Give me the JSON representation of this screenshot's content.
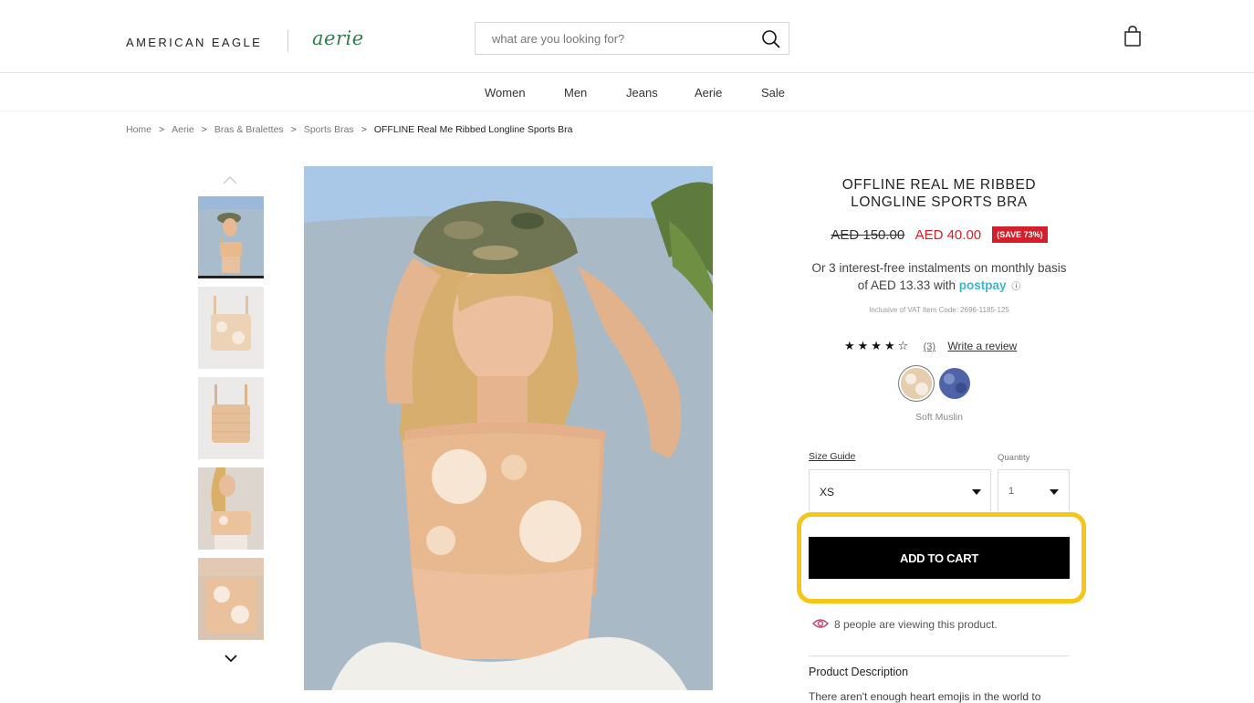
{
  "header": {
    "brand_ae": "AMERICAN EAGLE",
    "brand_aerie": "aerie",
    "search_placeholder": "what are you looking for?"
  },
  "nav": {
    "items": [
      "Women",
      "Men",
      "Jeans",
      "Aerie",
      "Sale"
    ]
  },
  "breadcrumb": {
    "items": [
      "Home",
      "Aerie",
      "Bras & Bralettes",
      "Sports Bras"
    ],
    "current": "OFFLINE Real Me Ribbed Longline Sports Bra",
    "separator": ">"
  },
  "product": {
    "title": "OFFLINE REAL ME RIBBED LONGLINE SPORTS BRA",
    "old_price": "AED 150.00",
    "new_price": "AED 40.00",
    "save_badge": "(SAVE 73%)",
    "postpay_text_1": "Or 3 interest-free instalments on monthly basis of AED 13.33 with",
    "postpay_brand": "postpay",
    "info_icon": "ⓘ",
    "vat_text": "Inclusive of VAT    Item Code: 2696-1185-125",
    "rating": {
      "stars_text": "★★★★☆",
      "value": 4,
      "max": 5,
      "count": "(3)",
      "write_review": "Write a review"
    },
    "colors": [
      {
        "name": "Soft Muslin",
        "swatch": "#e8d6bd",
        "selected": true
      },
      {
        "name": "",
        "swatch": "#4e63a8",
        "selected": false
      }
    ],
    "selected_color_name": "Soft Muslin",
    "size_guide": "Size Guide",
    "quantity_label": "Quantity",
    "size_value": "XS",
    "quantity_value": "1",
    "add_to_cart": "ADD TO CART",
    "viewers_text": "8 people are viewing this product.",
    "description_heading": "Product Description",
    "description_text": "There aren't enough heart emojis in the world to"
  },
  "colors": {
    "price_red": "#d4202a",
    "highlight": "#f5c518",
    "postpay": "#3eb5c8",
    "aerie_green": "#2e7d4a",
    "eye": "#c0436f"
  },
  "icons": [
    "search-icon",
    "bag-icon",
    "chevron-up-icon",
    "chevron-down-icon",
    "eye-icon",
    "info-icon",
    "caret-down-icon"
  ]
}
